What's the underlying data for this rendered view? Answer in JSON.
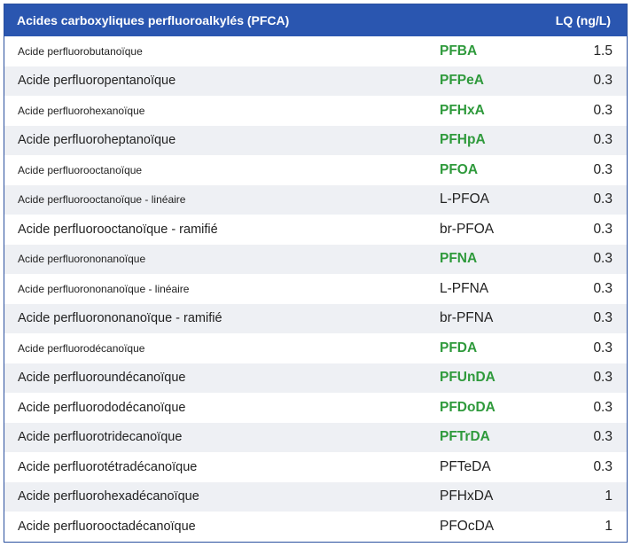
{
  "table": {
    "header": {
      "title": "Acides carboxyliques perfluoroalkylés (PFCA)",
      "lq_label": "LQ (ng/L)"
    },
    "rows": [
      {
        "name": "Acide perfluorobutanoïque",
        "abbr": "PFBA",
        "lq": "1.5",
        "highlight": true,
        "small": true
      },
      {
        "name": "Acide perfluoropentanoïque",
        "abbr": "PFPeA",
        "lq": "0.3",
        "highlight": true,
        "small": false
      },
      {
        "name": "Acide perfluorohexanoïque",
        "abbr": "PFHxA",
        "lq": "0.3",
        "highlight": true,
        "small": true
      },
      {
        "name": "Acide perfluoroheptanoïque",
        "abbr": "PFHpA",
        "lq": "0.3",
        "highlight": true,
        "small": false
      },
      {
        "name": "Acide perfluorooctanoïque",
        "abbr": "PFOA",
        "lq": "0.3",
        "highlight": true,
        "small": true
      },
      {
        "name": "Acide perfluorooctanoïque - linéaire",
        "abbr": "L-PFOA",
        "lq": "0.3",
        "highlight": false,
        "small": true
      },
      {
        "name": "Acide perfluorooctanoïque - ramifié",
        "abbr": "br-PFOA",
        "lq": "0.3",
        "highlight": false,
        "small": false
      },
      {
        "name": "Acide perfluorononanoïque",
        "abbr": "PFNA",
        "lq": "0.3",
        "highlight": true,
        "small": true
      },
      {
        "name": "Acide perfluorononanoïque - linéaire",
        "abbr": "L-PFNA",
        "lq": "0.3",
        "highlight": false,
        "small": true
      },
      {
        "name": "Acide perfluorononanoïque - ramifié",
        "abbr": "br-PFNA",
        "lq": "0.3",
        "highlight": false,
        "small": false
      },
      {
        "name": "Acide perfluorodécanoïque",
        "abbr": "PFDA",
        "lq": "0.3",
        "highlight": true,
        "small": true
      },
      {
        "name": "Acide perfluoroundécanoïque",
        "abbr": "PFUnDA",
        "lq": "0.3",
        "highlight": true,
        "small": false
      },
      {
        "name": "Acide perfluorododécanoïque",
        "abbr": "PFDoDA",
        "lq": "0.3",
        "highlight": true,
        "small": false
      },
      {
        "name": "Acide perfluorotridecanoïque",
        "abbr": "PFTrDA",
        "lq": "0.3",
        "highlight": true,
        "small": false
      },
      {
        "name": "Acide perfluorotétradécanoïque",
        "abbr": "PFTeDA",
        "lq": "0.3",
        "highlight": false,
        "small": false
      },
      {
        "name": "Acide perfluorohexadécanoïque",
        "abbr": "PFHxDA",
        "lq": "1",
        "highlight": false,
        "small": false
      },
      {
        "name": "Acide perfluorooctadécanoïque",
        "abbr": "PFOcDA",
        "lq": "1",
        "highlight": false,
        "small": false
      }
    ]
  },
  "colors": {
    "header_bg": "#2a56b0",
    "header_text": "#ffffff",
    "highlight_text": "#2f9a3c",
    "alt_row_bg": "#eef0f4",
    "border": "#2a4f9e"
  }
}
